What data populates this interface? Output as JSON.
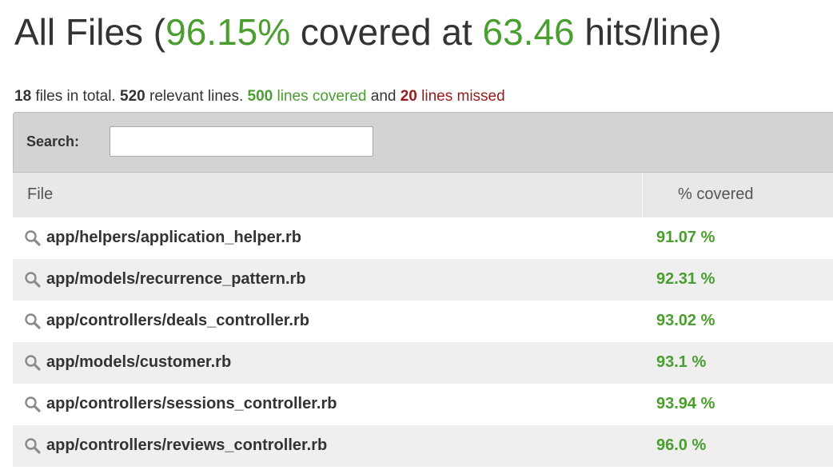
{
  "title": {
    "prefix": "All Files (",
    "coverage": "96.15%",
    "middle": " covered at ",
    "hits": "63.46",
    "suffix": " hits/line)"
  },
  "summary": {
    "files_count": "18",
    "files_text": " files in total. ",
    "relevant_count": "520",
    "relevant_text": " relevant lines. ",
    "covered_count": "500",
    "covered_text": " lines covered",
    "and_text": " and ",
    "missed_count": "20",
    "missed_text": " lines missed"
  },
  "search": {
    "label": "Search:",
    "value": ""
  },
  "table": {
    "columns": [
      "File",
      "% covered"
    ],
    "rows": [
      {
        "file": "app/helpers/application_helper.rb",
        "covered": "91.07 %",
        "icon": "magnifier-icon"
      },
      {
        "file": "app/models/recurrence_pattern.rb",
        "covered": "92.31 %",
        "icon": "magnifier-icon"
      },
      {
        "file": "app/controllers/deals_controller.rb",
        "covered": "93.02 %",
        "icon": "magnifier-icon"
      },
      {
        "file": "app/models/customer.rb",
        "covered": "93.1 %",
        "icon": "magnifier-icon"
      },
      {
        "file": "app/controllers/sessions_controller.rb",
        "covered": "93.94 %",
        "icon": "magnifier-icon"
      },
      {
        "file": "app/controllers/reviews_controller.rb",
        "covered": "96.0 %",
        "icon": "magnifier-icon"
      }
    ]
  },
  "colors": {
    "covered": "#4a9e2f",
    "missed": "#9a1b1b",
    "search_bar": "#d3d3d3",
    "header_row": "#e8e8e8",
    "alt_row": "#efefef"
  }
}
